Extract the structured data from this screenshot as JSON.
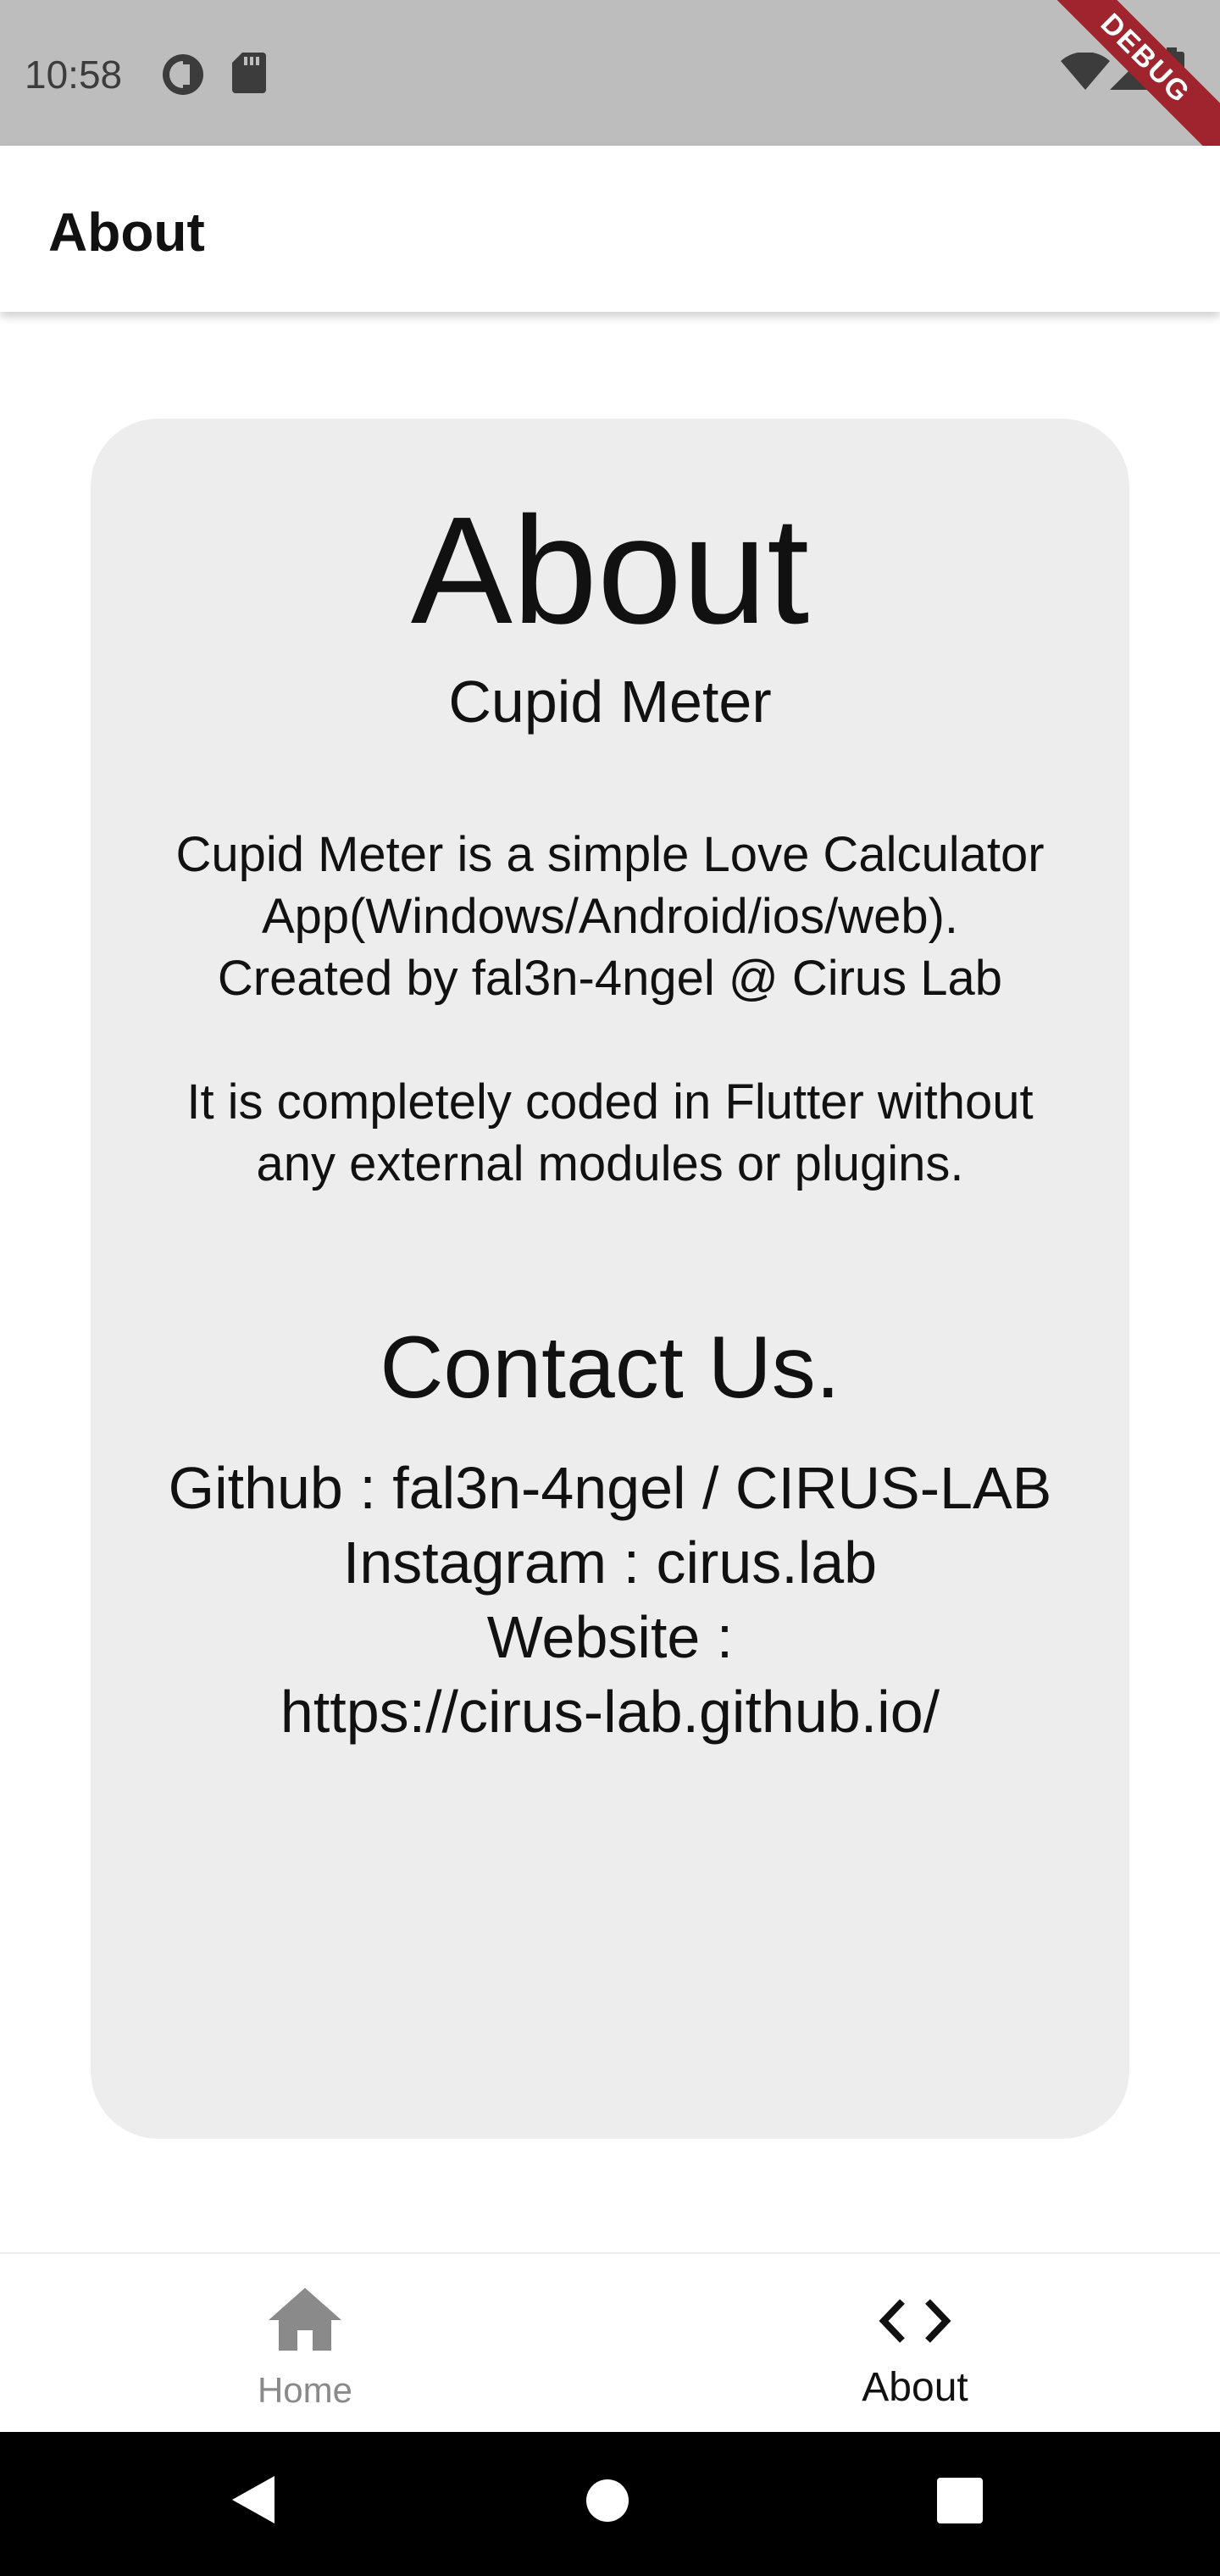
{
  "status_bar": {
    "time": "10:58",
    "icons": [
      "data-saver-icon",
      "sd-card-icon",
      "wifi-icon",
      "signal-icon",
      "battery-icon"
    ]
  },
  "debug_banner": {
    "label": "DEBUG"
  },
  "app_bar": {
    "title": "About"
  },
  "card": {
    "heading": "About",
    "subtitle": "Cupid Meter",
    "description_lines": [
      "Cupid Meter is a simple Love Calculator",
      "App(Windows/Android/ios/web).",
      "Created by fal3n-4ngel @ Cirus Lab",
      "It is completely coded in Flutter without",
      "any external modules or plugins."
    ],
    "contact_heading": "Contact Us.",
    "contact_lines": [
      "Github : fal3n-4ngel / CIRUS-LAB",
      "Instagram : cirus.lab",
      "Website :",
      "https://cirus-lab.github.io/"
    ]
  },
  "bottom_nav": {
    "items": [
      {
        "label": "Home",
        "icon": "home-icon",
        "selected": false
      },
      {
        "label": "About",
        "icon": "code-icon",
        "selected": true
      }
    ]
  },
  "system_nav": {
    "buttons": [
      "back-icon",
      "home-circle-icon",
      "recents-icon"
    ]
  },
  "colors": {
    "status_bar": "#bdbdbd",
    "card_background": "#ededed",
    "selected": "#111111",
    "unselected": "#8a8a8a",
    "debug_ribbon": "#a0242e"
  }
}
